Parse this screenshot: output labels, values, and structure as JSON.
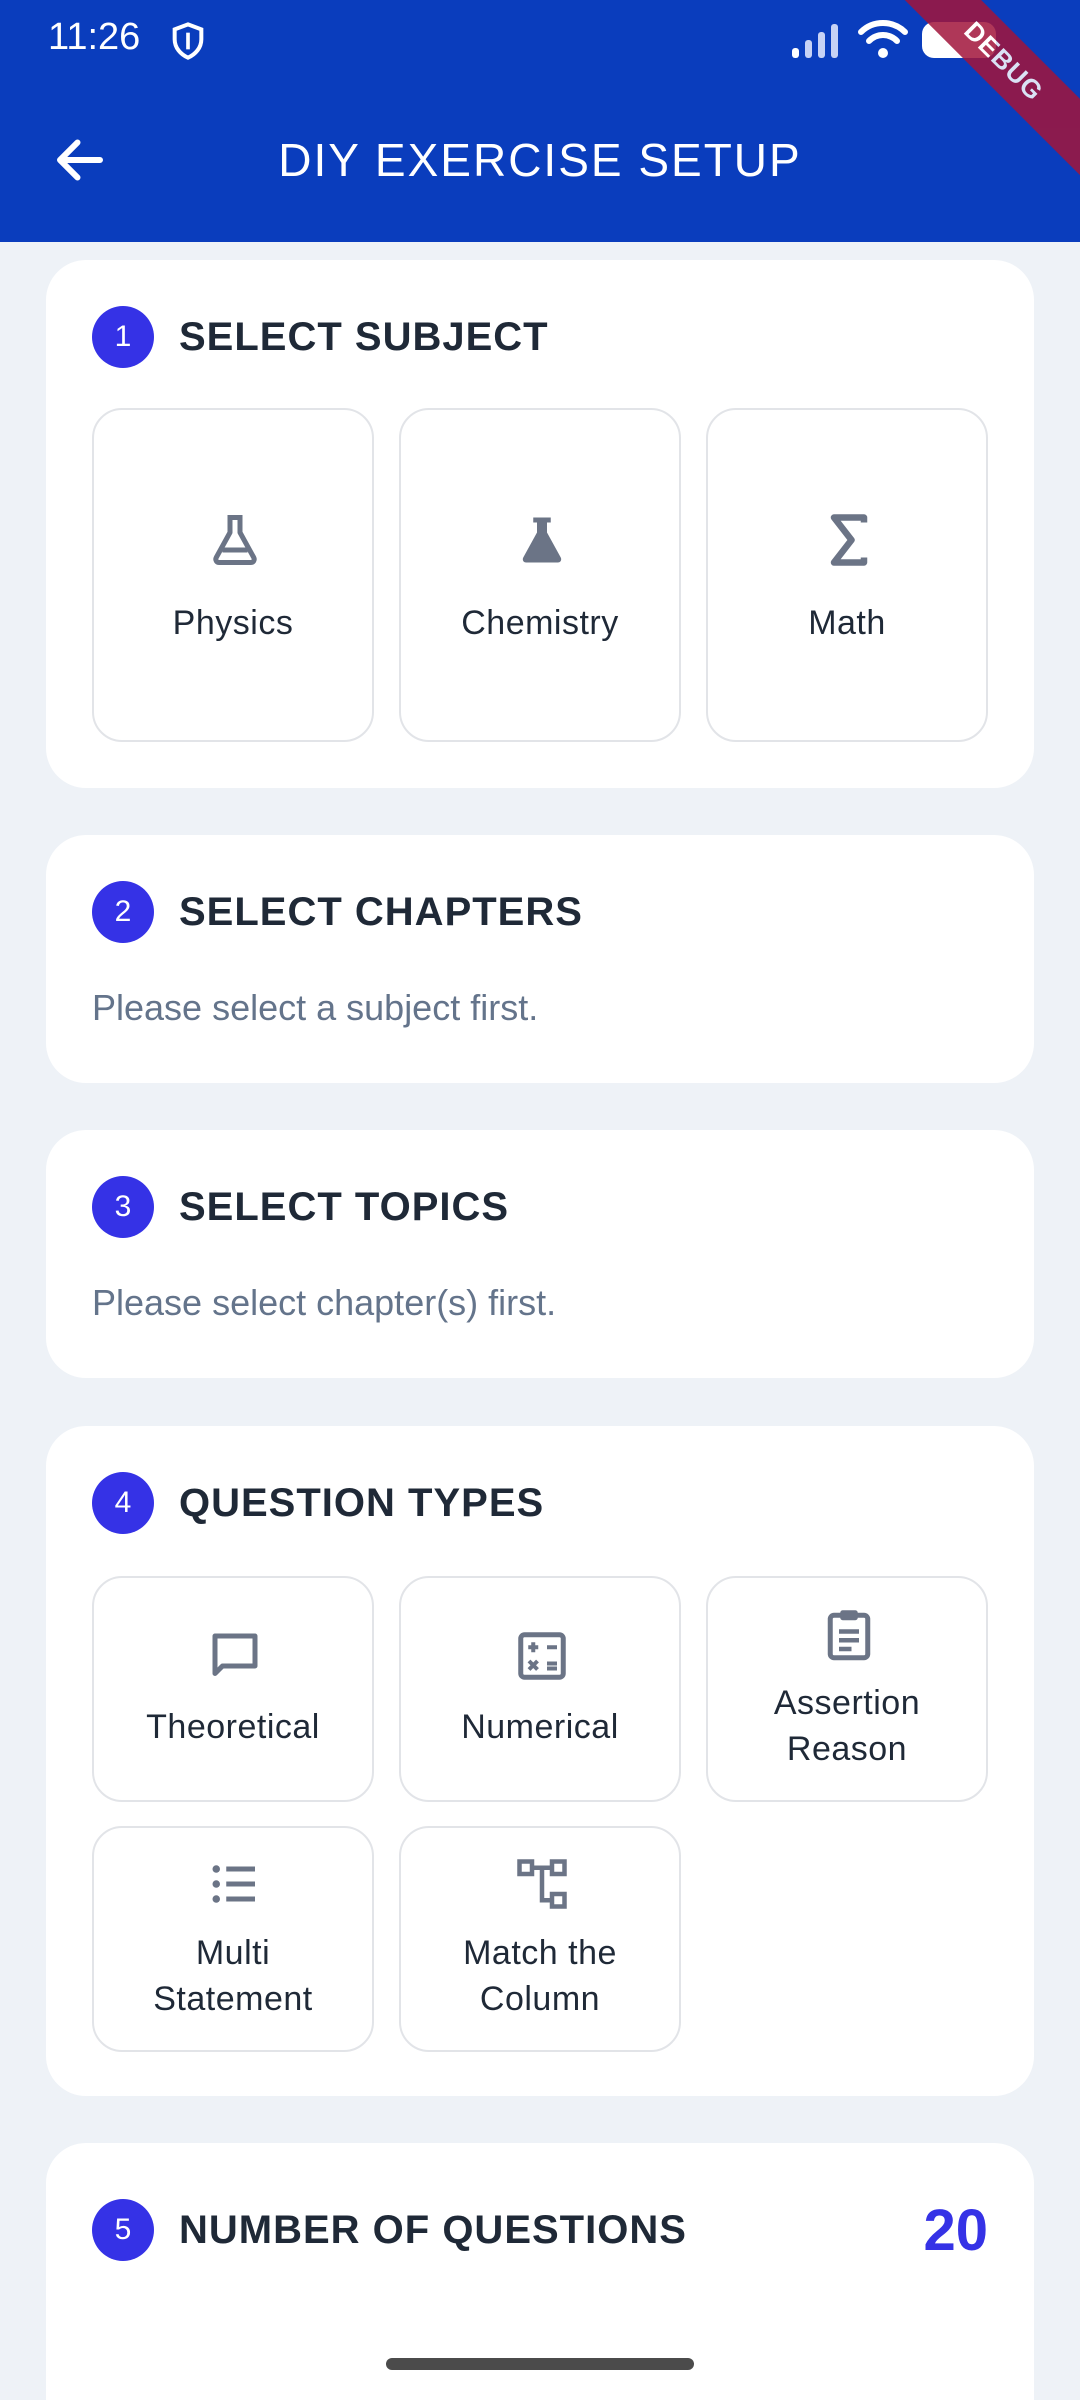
{
  "status_bar": {
    "time": "11:26"
  },
  "debug_banner": "DEBUG",
  "header": {
    "title": "DIY EXERCISE SETUP"
  },
  "sections": {
    "subject": {
      "step": "1",
      "title": "SELECT SUBJECT",
      "options": [
        {
          "label": "Physics",
          "icon": "flask-outline-icon"
        },
        {
          "label": "Chemistry",
          "icon": "flask-filled-icon"
        },
        {
          "label": "Math",
          "icon": "sigma-icon"
        }
      ]
    },
    "chapters": {
      "step": "2",
      "title": "SELECT CHAPTERS",
      "hint": "Please select a subject first."
    },
    "topics": {
      "step": "3",
      "title": "SELECT TOPICS",
      "hint": "Please select chapter(s) first."
    },
    "question_types": {
      "step": "4",
      "title": "QUESTION TYPES",
      "options": [
        {
          "label": "Theoretical",
          "icon": "chat-bubble-icon"
        },
        {
          "label": "Numerical",
          "icon": "calculator-icon"
        },
        {
          "label": "Assertion Reason",
          "line1": "Assertion",
          "line2": "Reason",
          "icon": "clipboard-icon"
        },
        {
          "label": "Multi Statement",
          "line1": "Multi",
          "line2": "Statement",
          "icon": "list-icon"
        },
        {
          "label": "Match the Column",
          "line1": "Match the",
          "line2": "Column",
          "icon": "schema-icon"
        }
      ]
    },
    "num_questions": {
      "step": "5",
      "title": "NUMBER OF QUESTIONS",
      "value": "20"
    }
  },
  "colors": {
    "header": "#0a3dbd",
    "accent": "#3532e6",
    "background": "#eef2f7",
    "icon": "#6b7486"
  }
}
